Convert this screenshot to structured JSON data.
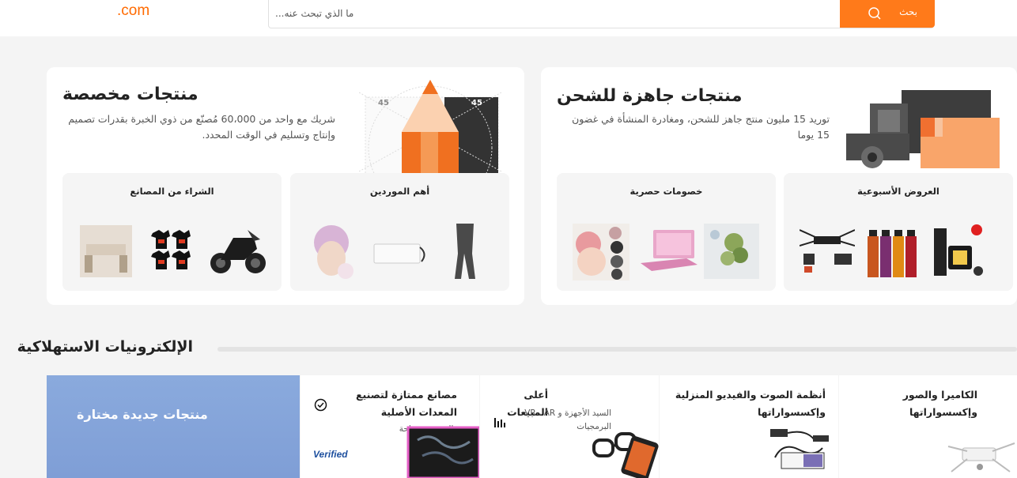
{
  "header": {
    "logo_text": ".com",
    "search_placeholder": "ما الذي تبحث عنه...",
    "search_button": "بحث"
  },
  "ready_to_ship": {
    "title": "منتجات جاهزة للشحن",
    "description": "توريد 15 مليون منتج جاهز للشحن، ومغادرة المنشأة في غضون 15 يوما",
    "subcards": [
      {
        "title": "العروض الأسبوعية"
      },
      {
        "title": "خصومات حصرية"
      }
    ]
  },
  "custom_products": {
    "title": "منتجات مخصصة",
    "description": "شريك مع واحد من 60،000 مُصنّع من ذوي الخبرة بقدرات تصميم وإنتاج وتسليم في الوقت المحدد.",
    "subcards": [
      {
        "title": "أهم الموردين"
      },
      {
        "title": "الشراء من المصانع"
      }
    ],
    "pencil_numbers": [
      "45",
      "45"
    ]
  },
  "section": {
    "title": "الإلكترونيات الاستهلاكية",
    "promo": "منتجات جديدة مختارة",
    "categories": [
      {
        "title": "الكاميرا والصور وإكسسواراتها"
      },
      {
        "title": "أنظمة الصوت والفيديو المنزلية وإكسسواراتها"
      },
      {
        "title": "أعلى المبيعات",
        "subtitle": "السيد الأجهزة و VR ، AR البرمجيات"
      },
      {
        "title": "مصانع ممتازة لتصنيع المعدات الأصلية",
        "subtitle": "خدمة التخصيص متاحة",
        "badge": "Verified"
      }
    ]
  },
  "colors": {
    "accent": "#ff6a00",
    "search_button": "#ff7a1a",
    "promo_blue": "#7f9ed6"
  }
}
